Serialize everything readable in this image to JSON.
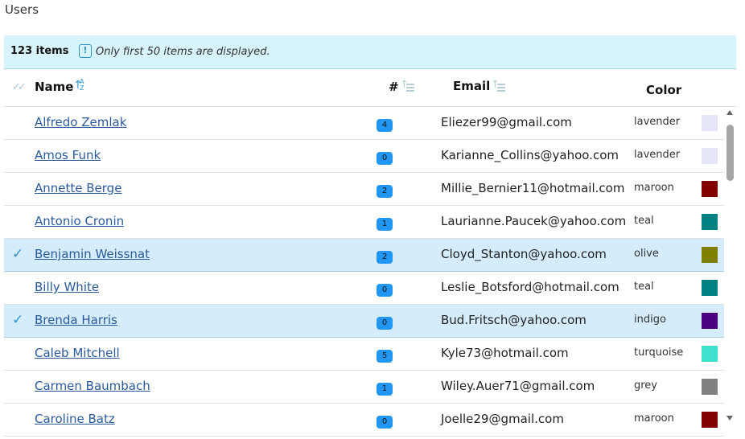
{
  "page": {
    "title": "Users"
  },
  "info_bar": {
    "count": "123 items",
    "icon": "info-icon",
    "message": "Only first 50 items are displayed."
  },
  "columns": {
    "name": "Name",
    "number": "#",
    "email": "Email",
    "color": "Color"
  },
  "rows": [
    {
      "name": "Alfredo Zemlak",
      "count": "4",
      "email": "Eliezer99@gmail.com",
      "color_name": "lavender",
      "color_hex": "#e6e6fa",
      "selected": false
    },
    {
      "name": "Amos Funk",
      "count": "0",
      "email": "Karianne_Collins@yahoo.com",
      "color_name": "lavender",
      "color_hex": "#e6e6fa",
      "selected": false
    },
    {
      "name": "Annette Berge",
      "count": "2",
      "email": "Millie_Bernier11@hotmail.com",
      "color_name": "maroon",
      "color_hex": "#800000",
      "selected": false
    },
    {
      "name": "Antonio Cronin",
      "count": "1",
      "email": "Laurianne.Paucek@yahoo.com",
      "color_name": "teal",
      "color_hex": "#008080",
      "selected": false
    },
    {
      "name": "Benjamin Weissnat",
      "count": "2",
      "email": "Cloyd_Stanton@yahoo.com",
      "color_name": "olive",
      "color_hex": "#808000",
      "selected": true
    },
    {
      "name": "Billy White",
      "count": "0",
      "email": "Leslie_Botsford@hotmail.com",
      "color_name": "teal",
      "color_hex": "#008080",
      "selected": false
    },
    {
      "name": "Brenda Harris",
      "count": "0",
      "email": "Bud.Fritsch@yahoo.com",
      "color_name": "indigo",
      "color_hex": "#4b0082",
      "selected": true
    },
    {
      "name": "Caleb Mitchell",
      "count": "5",
      "email": "Kyle73@hotmail.com",
      "color_name": "turquoise",
      "color_hex": "#40e0d0",
      "selected": false
    },
    {
      "name": "Carmen Baumbach",
      "count": "1",
      "email": "Wiley.Auer71@gmail.com",
      "color_name": "grey",
      "color_hex": "#808080",
      "selected": false
    },
    {
      "name": "Caroline Batz",
      "count": "0",
      "email": "Joelle29@gmail.com",
      "color_name": "maroon",
      "color_hex": "#800000",
      "selected": false
    }
  ]
}
